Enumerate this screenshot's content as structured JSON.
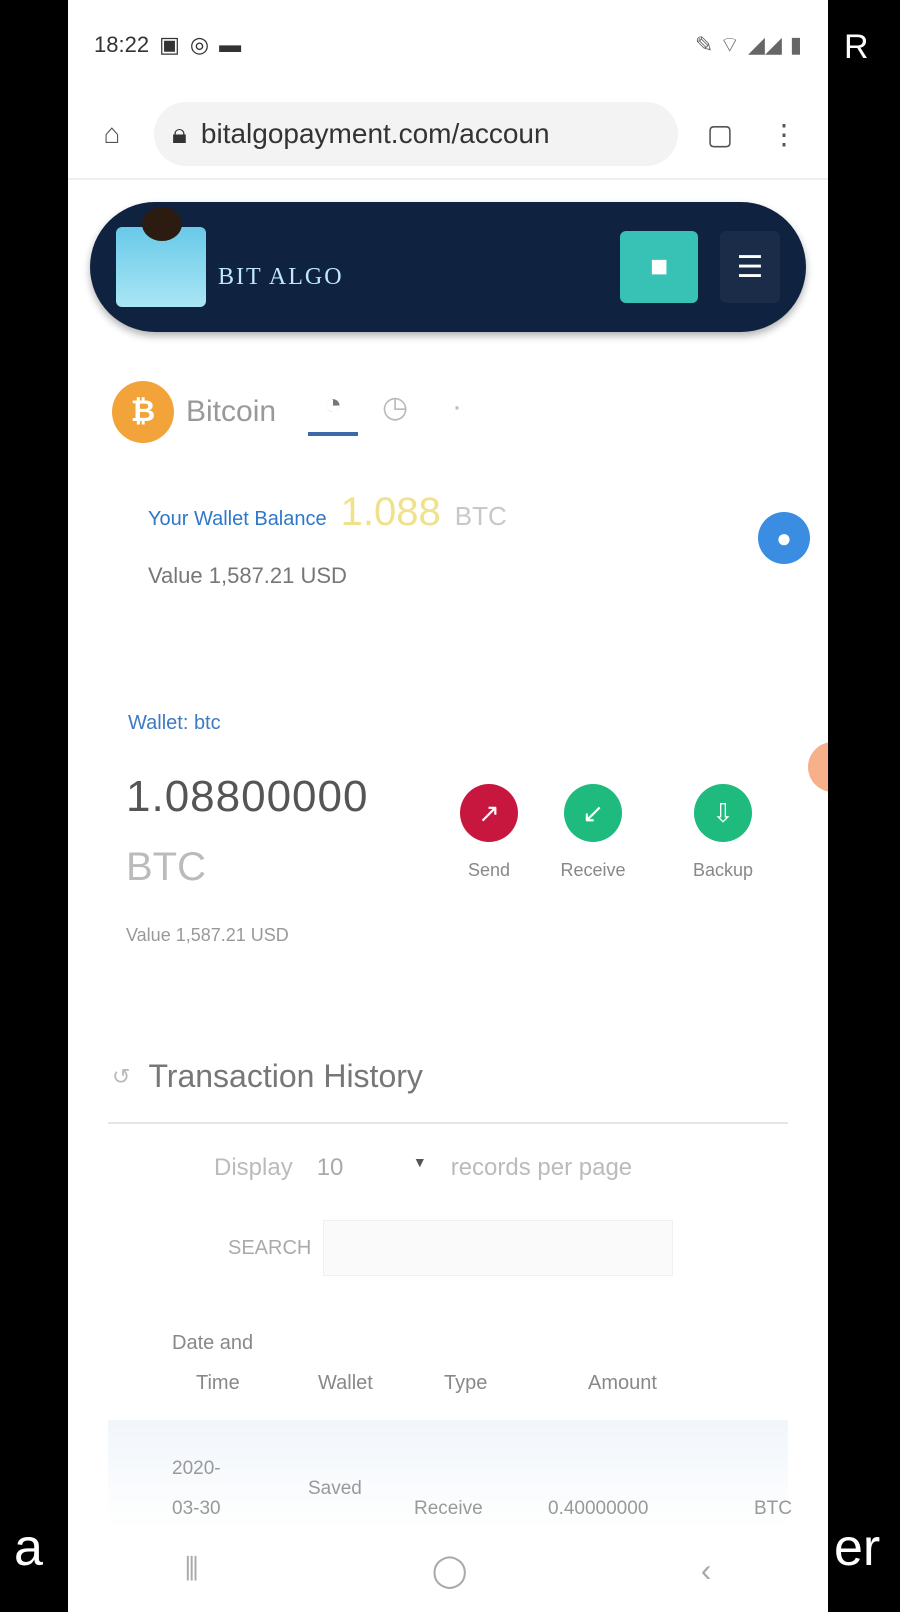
{
  "status_bar": {
    "time": "18:22",
    "right_text": "R"
  },
  "browser": {
    "url": "bitalgopayment.com/accoun"
  },
  "app_header": {
    "brand": "BIT ALGO"
  },
  "coin_tabs": {
    "coin_symbol": "₿",
    "coin_name": "Bitcoin"
  },
  "balance": {
    "label": "Your Wallet Balance",
    "amount": "1.088",
    "unit": "BTC",
    "value_text": "Value 1,587.21 USD"
  },
  "wallet": {
    "label": "Wallet: btc",
    "amount": "1.08800000",
    "unit": "BTC",
    "value_text": "Value 1,587.21 USD"
  },
  "actions": [
    {
      "label": "Send",
      "color": "#c8173f"
    },
    {
      "label": "Receive",
      "color": "#1fba7d"
    },
    {
      "label": "Backup",
      "color": "#1fba7d"
    }
  ],
  "transaction_history": {
    "title": "Transaction History",
    "display_label": "Display",
    "display_value": "10",
    "records_label": "records per page",
    "search_label": "SEARCH",
    "columns": [
      "Date and",
      "Time",
      "Wallet",
      "Type",
      "Amount"
    ],
    "row": {
      "date_line1": "2020-",
      "date_line2": "03-30",
      "wallet": "Saved",
      "type": "Receive",
      "amount": "0.40000000",
      "extra": "BTC"
    }
  },
  "side_captions": {
    "left": "a",
    "right": "er"
  },
  "colors": {
    "header_bg": "#0f2240",
    "accent_teal": "#38c1b5",
    "bitcoin_orange": "#f2a43a",
    "info_blue": "#3a8de0"
  }
}
